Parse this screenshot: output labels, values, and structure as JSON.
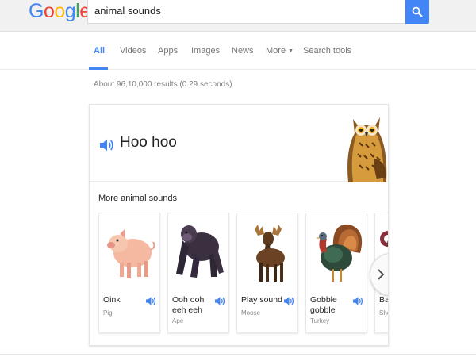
{
  "logo": {
    "letters": [
      "G",
      "o",
      "o",
      "g",
      "l",
      "e"
    ],
    "colors": [
      "#4285f4",
      "#ea4335",
      "#fbbc05",
      "#4285f4",
      "#34a853",
      "#ea4335"
    ]
  },
  "search": {
    "query": "animal sounds",
    "button_icon": "search-icon"
  },
  "tabs": [
    {
      "label": "All",
      "active": true
    },
    {
      "label": "Videos"
    },
    {
      "label": "Apps"
    },
    {
      "label": "Images"
    },
    {
      "label": "News"
    },
    {
      "label": "More"
    },
    {
      "label": "Search tools"
    }
  ],
  "result_stats": "About 96,10,000 results (0.29 seconds)",
  "featured": {
    "sound": "Hoo hoo",
    "animal_icon": "owl-icon"
  },
  "more_label": "More animal sounds",
  "animals": [
    {
      "sound": "Oink",
      "name": "Pig",
      "icon": "pig-icon"
    },
    {
      "sound": "Ooh ooh eeh eeh",
      "name": "Ape",
      "icon": "gorilla-icon"
    },
    {
      "sound": "Play sound",
      "name": "Moose",
      "icon": "moose-icon"
    },
    {
      "sound": "Gobble gobble",
      "name": "Turkey",
      "icon": "turkey-icon"
    },
    {
      "sound": "Ba",
      "name": "She",
      "icon": "sheep-icon"
    }
  ],
  "colors": {
    "accent": "#4285f4",
    "speaker": "#4285f4"
  }
}
